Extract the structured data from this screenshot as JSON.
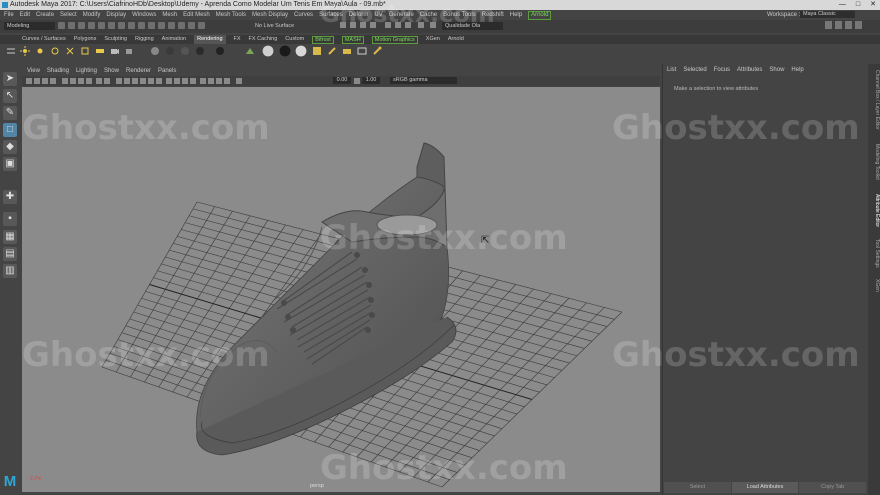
{
  "window": {
    "title": "Autodesk Maya 2017: C:\\Users\\CiafrinoHDb\\Desktop\\Udemy - Aprenda Como Modelar Um Tenis Em Maya\\Aula - 09.mb*",
    "controls": [
      "—",
      "□",
      "✕"
    ]
  },
  "menubar": {
    "items": [
      "File",
      "Edit",
      "Create",
      "Select",
      "Modify",
      "Display",
      "Windows",
      "Mesh",
      "Edit Mesh",
      "Mesh Tools",
      "Mesh Display",
      "Curves",
      "Surfaces",
      "Deform",
      "UV",
      "Generate",
      "Cache",
      "Bonus Tools",
      "Redshift",
      "Help"
    ],
    "highlight": "Arnold",
    "workspace_label": "Workspace :",
    "workspace_value": "Maya Classic"
  },
  "statusline": {
    "mode": "Modeling",
    "live_surface": "No Live Surface",
    "quality": "Qualidade Ola"
  },
  "shelf": {
    "tabs": [
      "Curves / Surfaces",
      "Polygons",
      "Sculpting",
      "Rigging",
      "Animation",
      "Rendering",
      "FX",
      "FX Caching",
      "Custom",
      "Bifrost",
      "MASH",
      "Motion Graphics",
      "XGen",
      "Arnold"
    ],
    "active_tab": "Rendering",
    "green_tabs": [
      "Bifrost",
      "MASH",
      "Motion Graphics"
    ]
  },
  "panel": {
    "menu": [
      "View",
      "Shading",
      "Lighting",
      "Show",
      "Renderer",
      "Panels"
    ],
    "field1": "0.00",
    "field2": "1.00",
    "color_space": "sRGB gamma",
    "camera_label": "persp",
    "axis": "z↗x"
  },
  "attribute_editor": {
    "menu": [
      "List",
      "Selected",
      "Focus",
      "Attributes",
      "Show",
      "Help"
    ],
    "message": "Make a selection to view attributes",
    "buttons": [
      "Select",
      "Load Attributes",
      "Copy Tab"
    ]
  },
  "side_tabs": [
    "Channel Box / Layer Editor",
    "Modeling Toolkit",
    "Attribute Editor",
    "Tool Settings",
    "XGen"
  ],
  "watermark": "Ghostxx.com",
  "colors": {
    "viewport_bg": "#8b8b8b",
    "grid": "#3a3a3a",
    "shoe": "#6a6a6a",
    "accent_green": "#7ddc5a",
    "accent_blue": "#5285a6"
  }
}
